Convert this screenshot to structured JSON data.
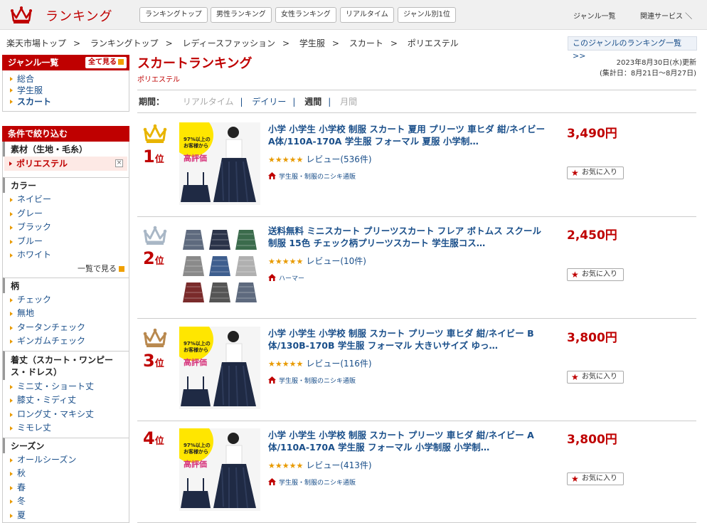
{
  "header": {
    "logo_text": "ランキング",
    "nav": [
      "ランキングトップ",
      "男性ランキング",
      "女性ランキング",
      "リアルタイム",
      "ジャンル別1位"
    ],
    "genre_list": "ジャンル一覧",
    "related": "関連サービス ＼"
  },
  "breadcrumb": [
    "楽天市場トップ",
    "ランキングトップ",
    "レディースファッション",
    "学生服",
    "スカート",
    "ポリエステル"
  ],
  "genre_ranking_link": "このジャンルのランキング一覧 >>",
  "sidebar": {
    "genre_head": "ジャンル一覧",
    "all_btn": "全て見る",
    "genres": [
      "総合",
      "学生服",
      "スカート"
    ],
    "filter_head": "条件で絞り込む",
    "material_title": "素材（生地・毛糸）",
    "material_selected": "ポリエステル",
    "color_title": "カラー",
    "colors": [
      "ネイビー",
      "グレー",
      "ブラック",
      "ブルー",
      "ホワイト"
    ],
    "color_more": "一覧で見る",
    "pattern_title": "柄",
    "patterns": [
      "チェック",
      "無地",
      "タータンチェック",
      "ギンガムチェック"
    ],
    "length_title": "着丈（スカート・ワンピース・ドレス）",
    "lengths": [
      "ミニ丈・ショート丈",
      "膝丈・ミディ丈",
      "ロング丈・マキシ丈",
      "ミモレ丈"
    ],
    "season_title": "シーズン",
    "seasons": [
      "オールシーズン",
      "秋",
      "春",
      "冬",
      "夏"
    ]
  },
  "main": {
    "title": "スカートランキング",
    "subtitle": "ポリエステル",
    "date_line1": "2023年8月30日(水)更新",
    "date_line2": "(集計日：8月21日〜8月27日)",
    "period_label": "期間：",
    "periods": [
      "リアルタイム",
      "デイリー",
      "週間",
      "月間"
    ],
    "fav_label": "お気に入り",
    "items": [
      {
        "rank": "1",
        "rank_suffix": "位",
        "name": "小学 小学生 小学校 制服 スカート 夏用 プリーツ 車ヒダ 紺/ネイビー A体/110A-170A 学生服 フォーマル 夏服 小学制…",
        "stars": "★★★★★",
        "reviews": "レビュー(536件)",
        "shop": "学生服・制服のニシキ通販",
        "price": "3,490円",
        "crown_color": "#e8b400",
        "thumb_text": [
          "97%以上の",
          "お客様から",
          "高評価"
        ]
      },
      {
        "rank": "2",
        "rank_suffix": "位",
        "name": "送料無料 ミニスカート プリーツスカート フレア ボトムス スクール制服 15色 チェック柄プリーツスカート 学生服コス…",
        "stars": "★★★★★",
        "reviews": "レビュー(10件)",
        "shop": "ハーマー",
        "price": "2,450円",
        "crown_color": "#a9b7c6"
      },
      {
        "rank": "3",
        "rank_suffix": "位",
        "name": "小学 小学生 小学校 制服 スカート プリーツ 車ヒダ 紺/ネイビー B体/130B-170B 学生服 フォーマル 大きいサイズ ゆっ…",
        "stars": "★★★★★",
        "reviews": "レビュー(116件)",
        "shop": "学生服・制服のニシキ通販",
        "price": "3,800円",
        "crown_color": "#b9894f",
        "thumb_text": [
          "97%以上の",
          "お客様から",
          "高評価"
        ]
      },
      {
        "rank": "4",
        "rank_suffix": "位",
        "name": "小学 小学生 小学校 制服 スカート プリーツ 車ヒダ 紺/ネイビー A体/110A-170A 学生服 フォーマル 小学制服 小学制…",
        "stars": "★★★★★",
        "reviews": "レビュー(413件)",
        "shop": "学生服・制服のニシキ通販",
        "price": "3,800円",
        "thumb_text": [
          "97%以上の",
          "お客様から",
          "高評価"
        ]
      }
    ]
  }
}
